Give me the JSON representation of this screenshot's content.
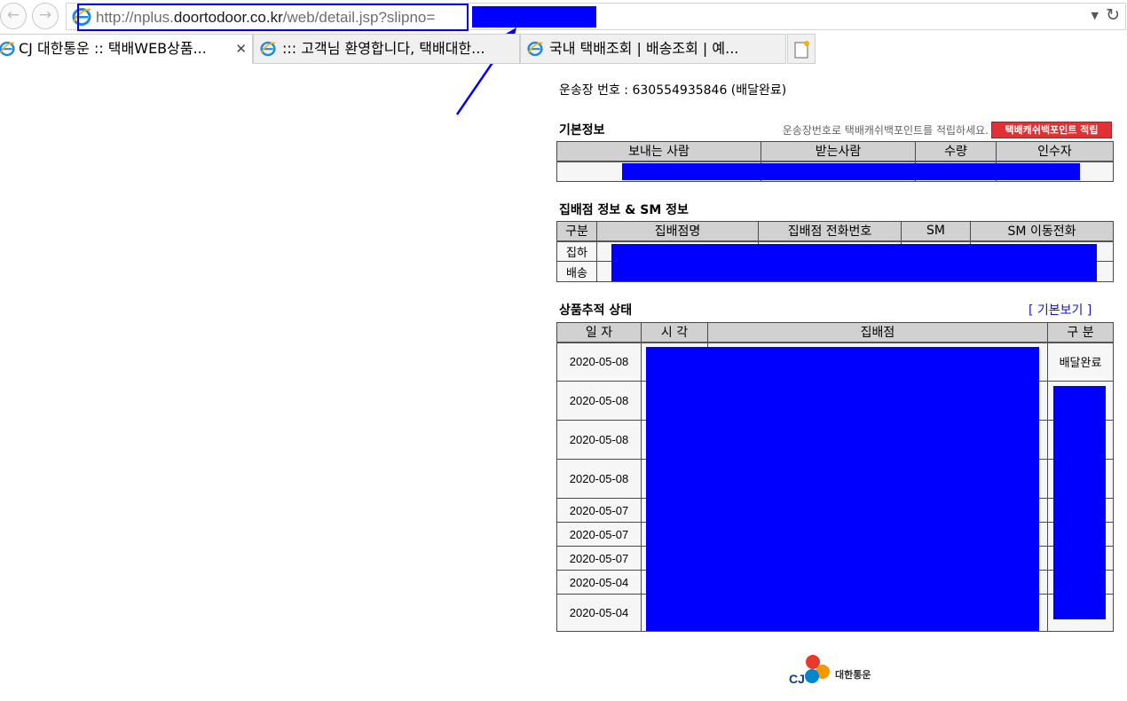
{
  "browser": {
    "address": {
      "prefix": "http://nplus.",
      "domain": "doortodoor.co.kr",
      "path": "/web/detail.jsp?slipno="
    },
    "icons": {
      "back": "back-arrow-icon",
      "forward": "forward-arrow-icon",
      "dropdown": "dropdown-caret-icon",
      "refresh": "refresh-icon",
      "browser": "ie-logo-icon",
      "close": "close-icon",
      "new_tab": "new-tab-icon"
    },
    "tabs": [
      {
        "title": "CJ 대한통운 :: 택배WEB상품...",
        "active": true
      },
      {
        "title": "::: 고객님 환영합니다, 택배대한...",
        "active": false
      },
      {
        "title": "국내 택배조회 | 배송조회 | 예...",
        "active": false
      }
    ],
    "redaction_color": "#0000ff"
  },
  "page": {
    "waybill_line": "운송장 번호 : 630554935846 (배달완료)",
    "basic": {
      "title": "기본정보",
      "point_message": "운송장번호로 택배캐쉬백포인트를 적립하세요.",
      "point_button": "택배캐쉬백포인트 적립",
      "headers": [
        "보내는 사람",
        "받는사람",
        "수량",
        "인수자"
      ]
    },
    "branch": {
      "title": "집배점 정보 & SM 정보",
      "headers": [
        "구분",
        "집배점명",
        "집배점 전화번호",
        "SM",
        "SM 이동전화"
      ],
      "rows": [
        "집하",
        "배송"
      ]
    },
    "tracking": {
      "title": "상품추적 상태",
      "view_link": "[ 기본보기 ]",
      "headers": [
        "일 자",
        "시 각",
        "집배점",
        "구 분"
      ],
      "rows": [
        {
          "date": "2020-05-08",
          "status": "배달완료"
        },
        {
          "date": "2020-05-08",
          "status": ""
        },
        {
          "date": "2020-05-08",
          "status": ""
        },
        {
          "date": "2020-05-08",
          "status": ""
        },
        {
          "date": "2020-05-07",
          "status": ""
        },
        {
          "date": "2020-05-07",
          "status": ""
        },
        {
          "date": "2020-05-07",
          "status": ""
        },
        {
          "date": "2020-05-04",
          "status": ""
        },
        {
          "date": "2020-05-04",
          "status": ""
        }
      ]
    },
    "logo": {
      "text": "대한통운",
      "colors": [
        "#e8392b",
        "#f39800",
        "#0086cf"
      ]
    }
  }
}
